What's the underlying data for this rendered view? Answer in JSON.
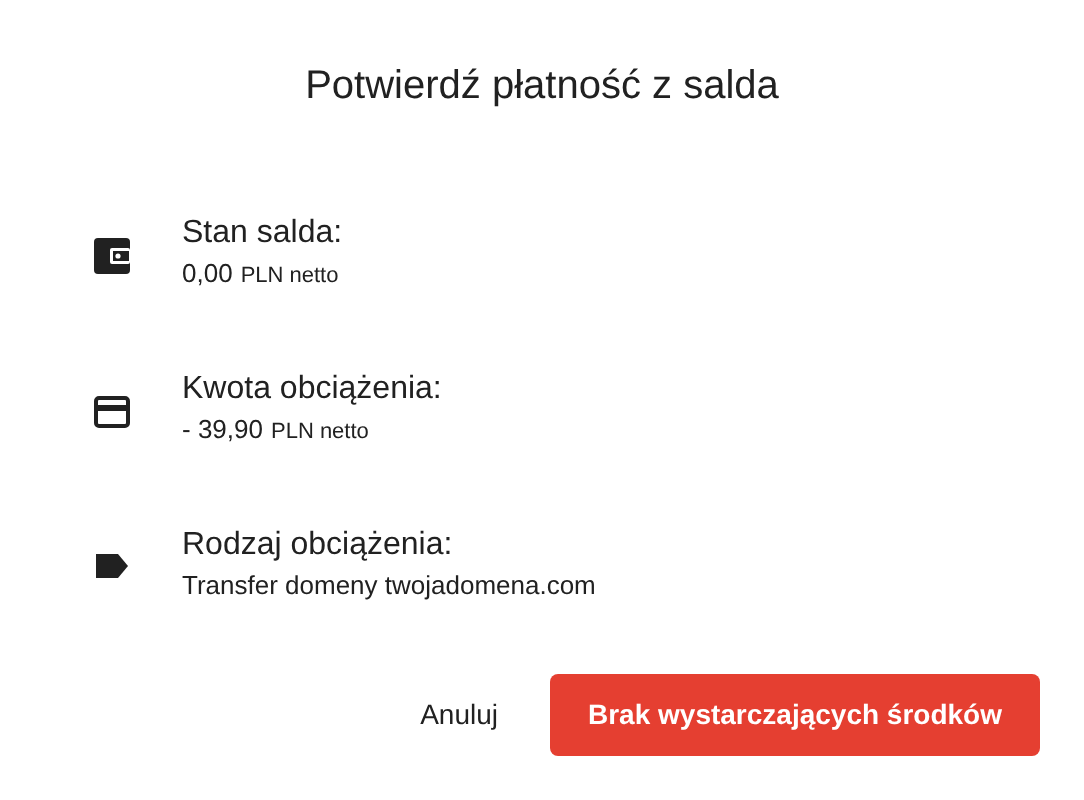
{
  "dialog": {
    "title": "Potwierdź płatność z salda",
    "items": [
      {
        "kind": "wallet",
        "label": "Stan salda:",
        "value": "0,00",
        "unit": "PLN netto"
      },
      {
        "kind": "card",
        "label": "Kwota obciążenia:",
        "value": "- 39,90",
        "unit": "PLN netto"
      },
      {
        "kind": "tag",
        "label": "Rodzaj obciążenia:",
        "value": "Transfer domeny twojadomena.com"
      }
    ],
    "buttons": [
      {
        "label": "Anuluj",
        "kind": "text"
      },
      {
        "label": "Brak wystarczających środków",
        "kind": "danger"
      }
    ]
  }
}
